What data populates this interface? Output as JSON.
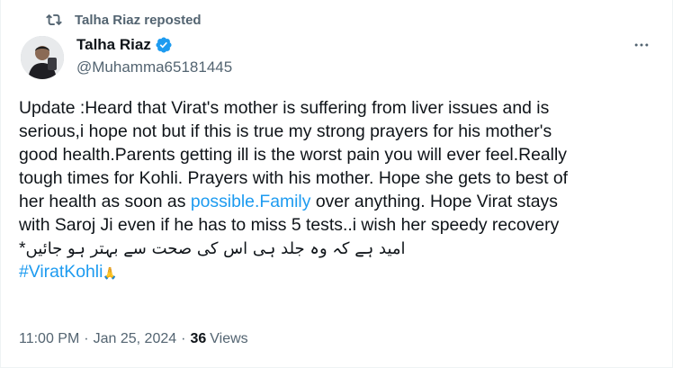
{
  "repost": {
    "label": "Talha Riaz reposted",
    "icon": "repost-icon"
  },
  "author": {
    "name": "Talha Riaz",
    "handle": "@Muhamma65181445",
    "verified_icon": "verified-badge-icon",
    "avatar_icon": "avatar"
  },
  "more_icon": "more-options-icon",
  "tweet": {
    "line1": "Update :Heard that Virat's mother is suffering from liver issues and is",
    "line2": "serious,i hope not but if this is true my strong prayers for his mother's",
    "line3": "good health.Parents getting ill is the worst pain you will ever feel.Really",
    "line4": "tough times for Kohli. Prayers with his mother. Hope she gets to best of",
    "line5_pre": "her health as soon as ",
    "line5_link": "possible.Family",
    "line5_post": " over anything. Hope Virat stays",
    "line6": "with Saroj Ji even if he has to miss 5 tests..i wish her speedy recovery",
    "line7_star": "*",
    "line7_urdu": "امید ہے کہ وہ جلد ہی اس کی صحت سے بہتر ہو جائیں",
    "hashtag": "#ViratKohli",
    "hashtag_emoji": "🙏"
  },
  "meta": {
    "time": "11:00 PM",
    "separator": "·",
    "date": "Jan 25, 2024",
    "views_count": "36",
    "views_label": "Views"
  },
  "colors": {
    "link": "#1d9bf0",
    "secondary": "#536471",
    "primary": "#0f1419"
  }
}
